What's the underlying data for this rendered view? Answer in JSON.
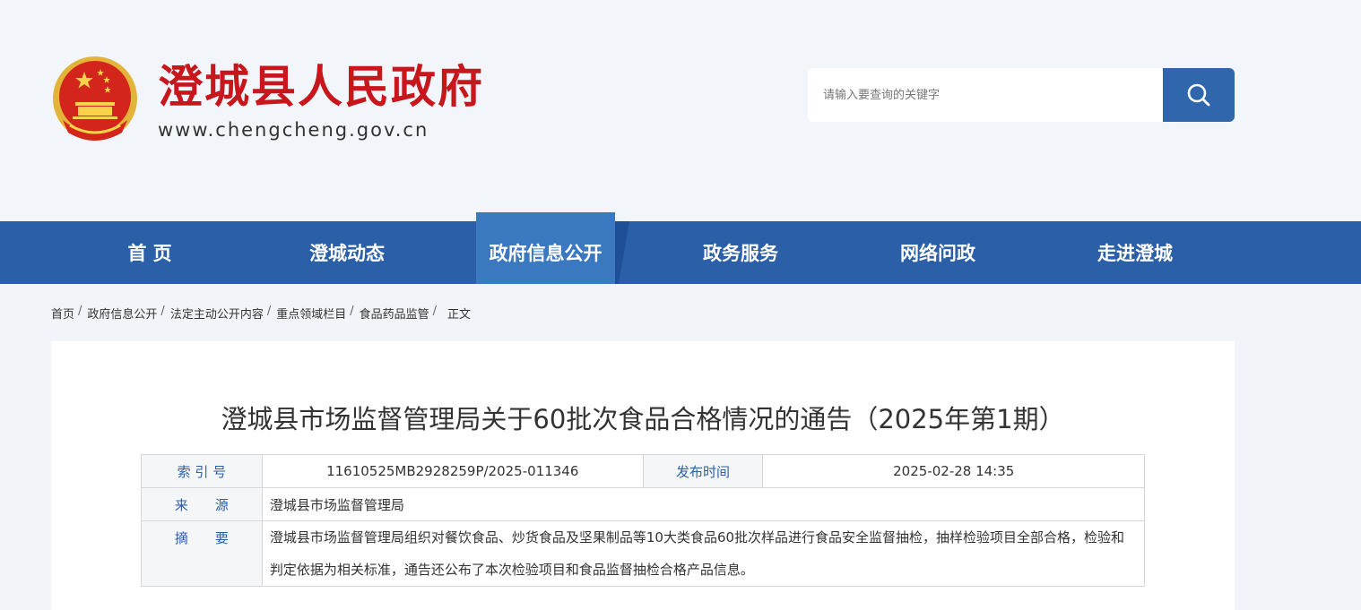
{
  "header": {
    "site_title": "澄城县人民政府",
    "site_url": "www.chengcheng.gov.cn",
    "search": {
      "placeholder": "请输入要查询的关键字",
      "value": ""
    }
  },
  "nav": {
    "items": [
      {
        "label": "首 页",
        "active": false
      },
      {
        "label": "澄城动态",
        "active": false
      },
      {
        "label": "政府信息公开",
        "active": true
      },
      {
        "label": "政务服务",
        "active": false
      },
      {
        "label": "网络问政",
        "active": false
      },
      {
        "label": "走进澄城",
        "active": false
      }
    ]
  },
  "breadcrumb": [
    "首页",
    "政府信息公开",
    "法定主动公开内容",
    "重点领域栏目",
    "食品药品监管",
    "正文"
  ],
  "article": {
    "title": "澄城县市场监督管理局关于60批次食品合格情况的通告（2025年第1期）",
    "meta": {
      "index_label": "索 引 号",
      "index_value": "11610525MB2928259P/2025-011346",
      "date_label": "发布时间",
      "date_value": "2025-02-28 14:35",
      "source_label": "来　　源",
      "source_value": "澄城县市场监督管理局",
      "summary_label": "摘　　要",
      "summary_value": "澄城县市场监督管理局组织对餐饮食品、炒货食品及坚果制品等10大类食品60批次样品进行食品安全监督抽检，抽样检验项目全部合格，检验和判定依据为相关标准，通告还公布了本次检验项目和食品监督抽检合格产品信息。"
    }
  },
  "colors": {
    "brand_red": "#c8161d",
    "nav_blue": "#2b5fa8",
    "nav_active": "#3a78c0",
    "search_button": "#2f66ac"
  },
  "icons": {
    "search": "search-icon",
    "emblem": "national-emblem-icon"
  }
}
